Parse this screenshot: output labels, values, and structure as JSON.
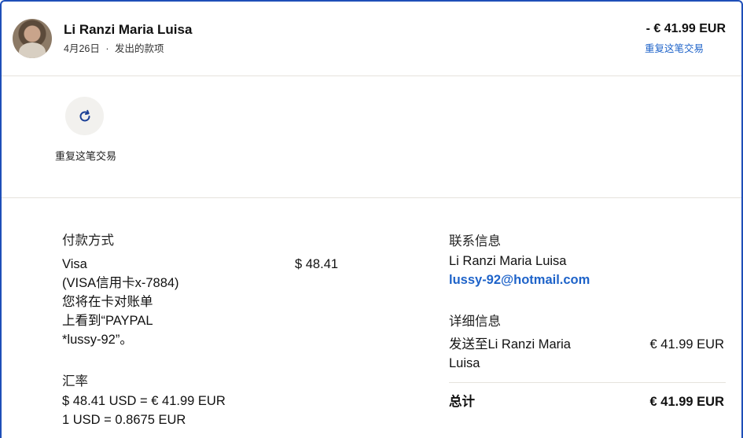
{
  "header": {
    "name": "Li Ranzi Maria Luisa",
    "date": "4月26日",
    "separator": "·",
    "type": "发出的款项",
    "amount": "- € 41.99 EUR",
    "repeat_link": "重复这笔交易"
  },
  "action": {
    "icon": "refresh-icon",
    "label": "重复这笔交易"
  },
  "payment": {
    "title": "付款方式",
    "card_name": "Visa",
    "card_detail": "(VISA信用卡x-7884)",
    "statement_line1": "您将在卡对账单",
    "statement_line2": "上看到“PAYPAL",
    "statement_line3": "*lussy-92”。",
    "amount": "$ 48.41"
  },
  "exchange": {
    "title": "汇率",
    "line1": "$ 48.41 USD = € 41.99 EUR",
    "line2": "1 USD = 0.8675 EUR"
  },
  "contact": {
    "title": "联系信息",
    "name": "Li Ranzi Maria Luisa",
    "email": "lussy-92@hotmail.com"
  },
  "details": {
    "title": "详细信息",
    "sent_to_line1": "发送至Li Ranzi Maria",
    "sent_to_line2": "Luisa",
    "sent_amount": "€ 41.99 EUR",
    "total_label": "总计",
    "total_amount": "€ 41.99 EUR"
  },
  "colors": {
    "accent": "#1e63c9",
    "frame_border": "#1e4fb8",
    "divider": "#e6e3dc"
  }
}
